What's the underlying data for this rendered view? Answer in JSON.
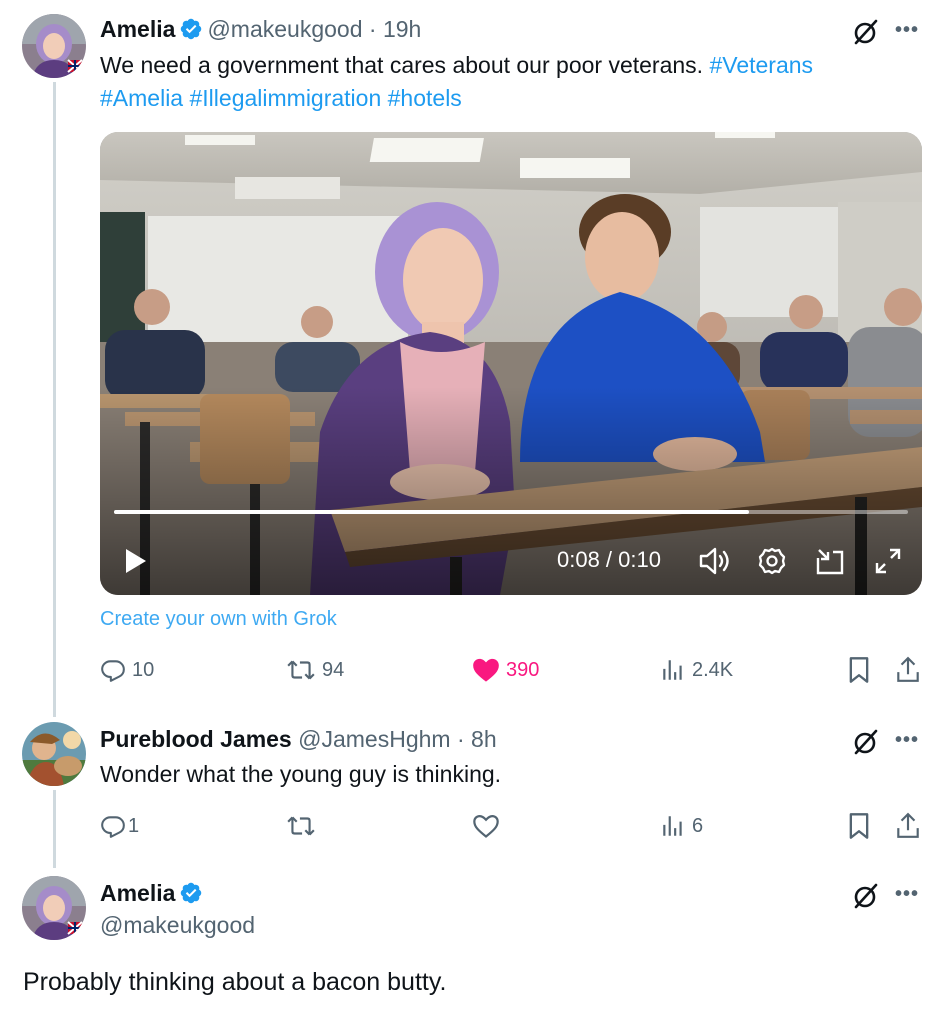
{
  "tweet1": {
    "name": "Amelia",
    "handle": "@makeukgood",
    "sep": "·",
    "time": "19h",
    "text": "We need a government that cares about our poor veterans. ",
    "hashtags": [
      "#Veterans",
      "#Amelia",
      "#Illegalimmigration",
      "#hotels"
    ],
    "video": {
      "time_display": "0:08 / 0:10",
      "progress": 0.8
    },
    "grok_link": "Create your own with Grok",
    "replies": "10",
    "reposts": "94",
    "likes": "390",
    "views": "2.4K"
  },
  "tweet2": {
    "name": "Pureblood James",
    "handle": "@JamesHghm",
    "sep": "·",
    "time": "8h",
    "text": "Wonder what the young guy is thinking.",
    "replies": "1",
    "views": "6"
  },
  "tweet3": {
    "name": "Amelia",
    "handle": "@makeukgood",
    "text": "Probably thinking about a bacon butty."
  },
  "colors": {
    "accent": "#1d9bf0",
    "like": "#f91880",
    "muted": "#536471",
    "text": "#0f1419",
    "thread_line": "#cfd9de"
  },
  "icons": [
    "verified-badge-icon",
    "grok-icon",
    "more-icon",
    "reply-icon",
    "repost-icon",
    "heart-icon",
    "views-icon",
    "bookmark-icon",
    "share-icon",
    "play-icon",
    "volume-icon",
    "settings-icon",
    "pip-icon",
    "fullscreen-icon"
  ]
}
